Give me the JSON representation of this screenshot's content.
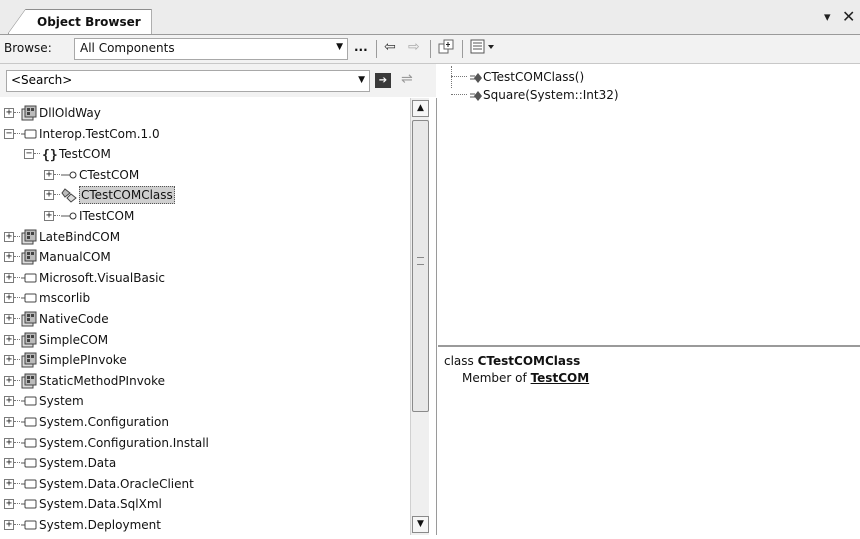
{
  "window": {
    "tab_title": "Object Browser",
    "dropdown_glyph": "▾",
    "close_glyph": "✕"
  },
  "toolbar": {
    "browse_label": "Browse:",
    "browse_value": "All Components",
    "ellipsis_label": "...",
    "icons": [
      "back-arrow-icon",
      "forward-arrow-icon",
      "add-reference-icon",
      "settings-icon"
    ]
  },
  "search": {
    "placeholder": "<Search>"
  },
  "tree": {
    "items": [
      {
        "label": "DllOldWay",
        "indent": 0,
        "expander": "+",
        "icon": "assembly-icon"
      },
      {
        "label": "Interop.TestCom.1.0",
        "indent": 0,
        "expander": "−",
        "icon": "com-component-icon"
      },
      {
        "label": "TestCOM",
        "indent": 1,
        "expander": "−",
        "icon": "namespace-icon"
      },
      {
        "label": "CTestCOM",
        "indent": 2,
        "expander": "+",
        "icon": "interface-icon"
      },
      {
        "label": "CTestCOMClass",
        "indent": 2,
        "expander": "+",
        "icon": "class-icon",
        "selected": true
      },
      {
        "label": "ITestCOM",
        "indent": 2,
        "expander": "+",
        "icon": "interface-icon"
      },
      {
        "label": "LateBindCOM",
        "indent": 0,
        "expander": "+",
        "icon": "assembly-icon"
      },
      {
        "label": "ManualCOM",
        "indent": 0,
        "expander": "+",
        "icon": "assembly-icon"
      },
      {
        "label": "Microsoft.VisualBasic",
        "indent": 0,
        "expander": "+",
        "icon": "com-component-icon"
      },
      {
        "label": "mscorlib",
        "indent": 0,
        "expander": "+",
        "icon": "com-component-icon"
      },
      {
        "label": "NativeCode",
        "indent": 0,
        "expander": "+",
        "icon": "assembly-icon"
      },
      {
        "label": "SimpleCOM",
        "indent": 0,
        "expander": "+",
        "icon": "assembly-icon"
      },
      {
        "label": "SimplePInvoke",
        "indent": 0,
        "expander": "+",
        "icon": "assembly-icon"
      },
      {
        "label": "StaticMethodPInvoke",
        "indent": 0,
        "expander": "+",
        "icon": "assembly-icon"
      },
      {
        "label": "System",
        "indent": 0,
        "expander": "+",
        "icon": "com-component-icon"
      },
      {
        "label": "System.Configuration",
        "indent": 0,
        "expander": "+",
        "icon": "com-component-icon"
      },
      {
        "label": "System.Configuration.Install",
        "indent": 0,
        "expander": "+",
        "icon": "com-component-icon"
      },
      {
        "label": "System.Data",
        "indent": 0,
        "expander": "+",
        "icon": "com-component-icon"
      },
      {
        "label": "System.Data.OracleClient",
        "indent": 0,
        "expander": "+",
        "icon": "com-component-icon"
      },
      {
        "label": "System.Data.SqlXml",
        "indent": 0,
        "expander": "+",
        "icon": "com-component-icon"
      },
      {
        "label": "System.Deployment",
        "indent": 0,
        "expander": "+",
        "icon": "com-component-icon"
      }
    ]
  },
  "members": {
    "items": [
      {
        "label": "CTestCOMClass()",
        "icon": "method-icon"
      },
      {
        "label": "Square(System::Int32)",
        "icon": "method-icon"
      }
    ]
  },
  "description": {
    "keyword": "class",
    "name": "CTestCOMClass",
    "member_of_label": "Member of",
    "namespace_link": "TestCOM"
  }
}
